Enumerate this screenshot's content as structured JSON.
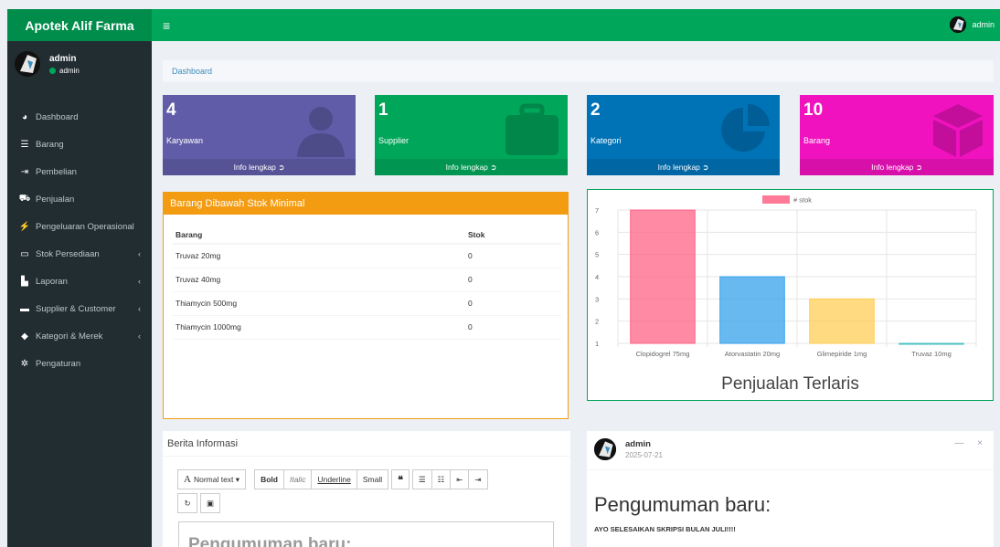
{
  "app": {
    "title": "Apotek Alif Farma"
  },
  "sidebar": {
    "user_name": "admin",
    "user_status": "admin",
    "items": [
      {
        "label": "Dashboard",
        "icon": "dashboard-icon",
        "submenu": false
      },
      {
        "label": "Barang",
        "icon": "list-icon",
        "submenu": false
      },
      {
        "label": "Pembelian",
        "icon": "sign-in-icon",
        "submenu": false
      },
      {
        "label": "Penjualan",
        "icon": "cart-icon",
        "submenu": false
      },
      {
        "label": "Pengeluaran Operasional",
        "icon": "bolt-icon",
        "submenu": false
      },
      {
        "label": "Stok Persediaan",
        "icon": "hdd-icon",
        "submenu": true
      },
      {
        "label": "Laporan",
        "icon": "bar-chart-icon",
        "submenu": true
      },
      {
        "label": "Supplier & Customer",
        "icon": "truck-icon",
        "submenu": true
      },
      {
        "label": "Kategori & Merek",
        "icon": "tag-icon",
        "submenu": true
      },
      {
        "label": "Pengaturan",
        "icon": "gear-icon",
        "submenu": false
      }
    ]
  },
  "topbar": {
    "menu_icon": "≡",
    "user": "admin"
  },
  "breadcrumb": "Dashboard",
  "stats": [
    {
      "value": "4",
      "label": "Karyawan",
      "link": "Info lengkap",
      "color": "#605ca8",
      "icon": "user-icon"
    },
    {
      "value": "1",
      "label": "Supplier",
      "link": "Info lengkap",
      "color": "#00a65a",
      "icon": "briefcase-icon"
    },
    {
      "value": "2",
      "label": "Kategori",
      "link": "Info lengkap",
      "color": "#0073b7",
      "icon": "pie-chart-icon"
    },
    {
      "value": "10",
      "label": "Barang",
      "link": "Info lengkap",
      "color": "#f012be",
      "icon": "cube-icon"
    }
  ],
  "low_stock": {
    "title": "Barang Dibawah Stok Minimal",
    "headers": [
      "Barang",
      "Stok"
    ],
    "rows": [
      [
        "Truvaz 20mg",
        "0"
      ],
      [
        "Truvaz 40mg",
        "0"
      ],
      [
        "Thiamycin 500mg",
        "0"
      ],
      [
        "Thiamycin 1000mg",
        "0"
      ]
    ]
  },
  "chart_data": {
    "type": "bar",
    "title": "Penjualan Terlaris",
    "categories": [
      "Clopidogrel 75mg",
      "Atorvastatin 20mg",
      "Glimepiride 1mg",
      "Truvaz 10mg"
    ],
    "series": [
      {
        "name": "# stok",
        "values": [
          7,
          4,
          3,
          1
        ]
      }
    ],
    "colors": [
      "#ff6384",
      "#36a2eb",
      "#ffce56",
      "#4bc0c0"
    ],
    "ylim": [
      1,
      7
    ],
    "yticks": [
      "1",
      "2",
      "3",
      "4",
      "5",
      "6",
      "7"
    ],
    "legend": "top",
    "grid": true
  },
  "news": {
    "title": "Berita Informasi",
    "toolbar": {
      "format": "Normal text",
      "bold": "Bold",
      "italic": "Italic",
      "underline": "Underline",
      "small": "Small",
      "quote": "❝"
    },
    "editor_preview": "Pengumuman baru:"
  },
  "post": {
    "author": "admin",
    "date": "2025-07-21",
    "tools": "— ×",
    "title": "Pengumuman baru:",
    "body": "AYO SELESAIKAN SKRIPSI BULAN JULI!!!!"
  }
}
